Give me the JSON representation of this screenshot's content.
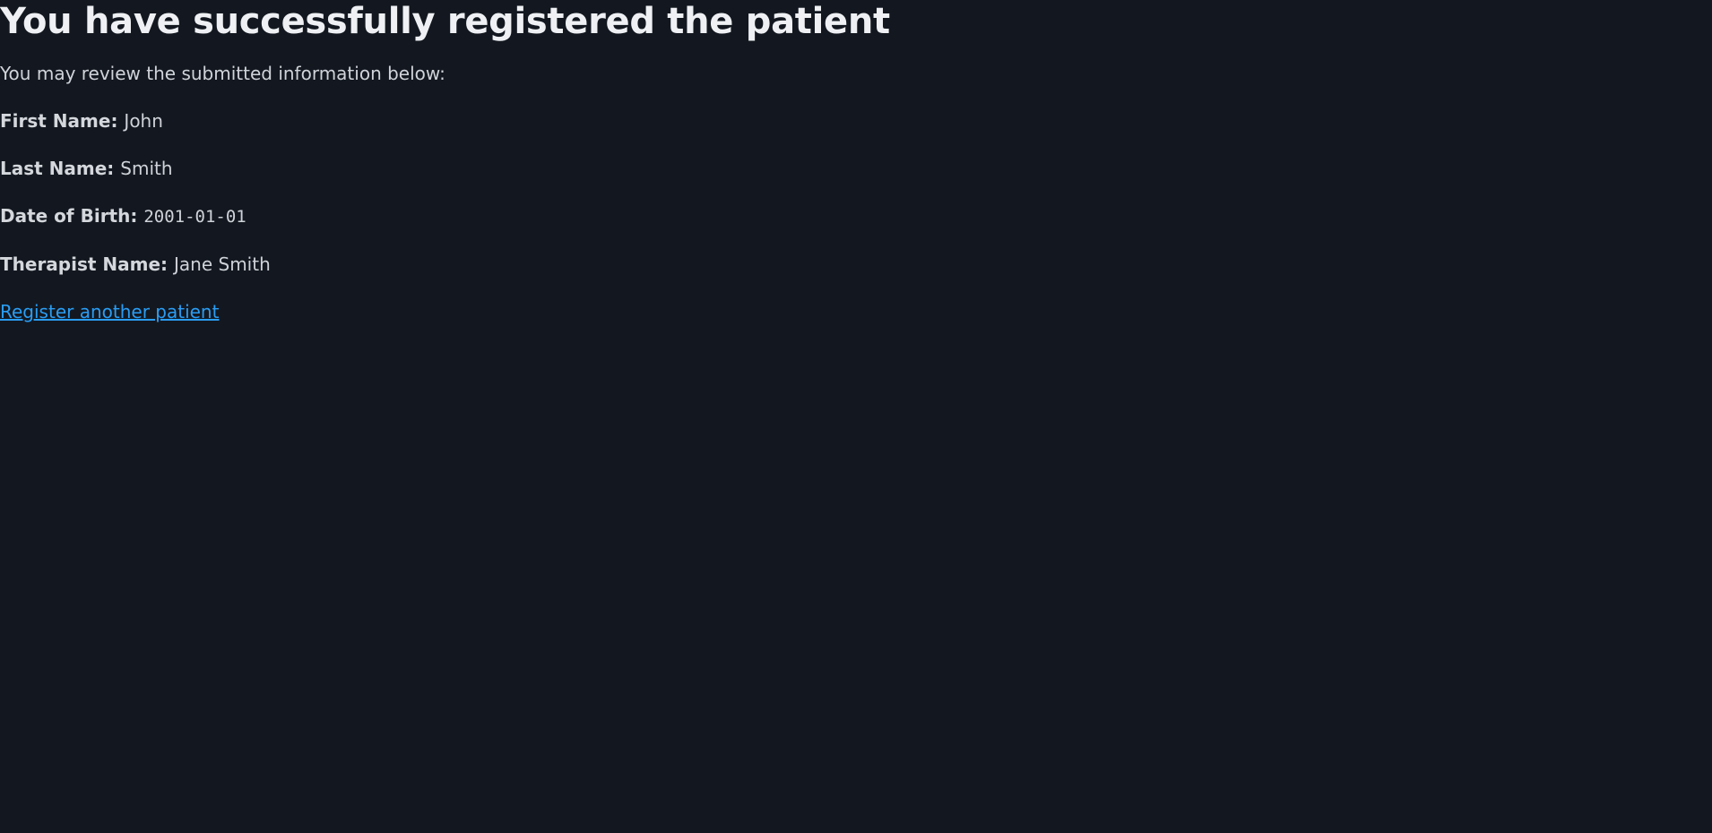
{
  "heading": "You have successfully registered the patient",
  "intro": "You may review the submitted information below:",
  "fields": [
    {
      "label": "First Name:",
      "value": "John"
    },
    {
      "label": "Last Name:",
      "value": "Smith"
    },
    {
      "label": "Date of Birth:",
      "value": "2001-01-01"
    },
    {
      "label": "Therapist Name:",
      "value": "Jane Smith"
    }
  ],
  "link": {
    "label": "Register another patient"
  },
  "colors": {
    "background": "#131820",
    "link": "#2a9df4",
    "heading": "#eef0f3"
  }
}
